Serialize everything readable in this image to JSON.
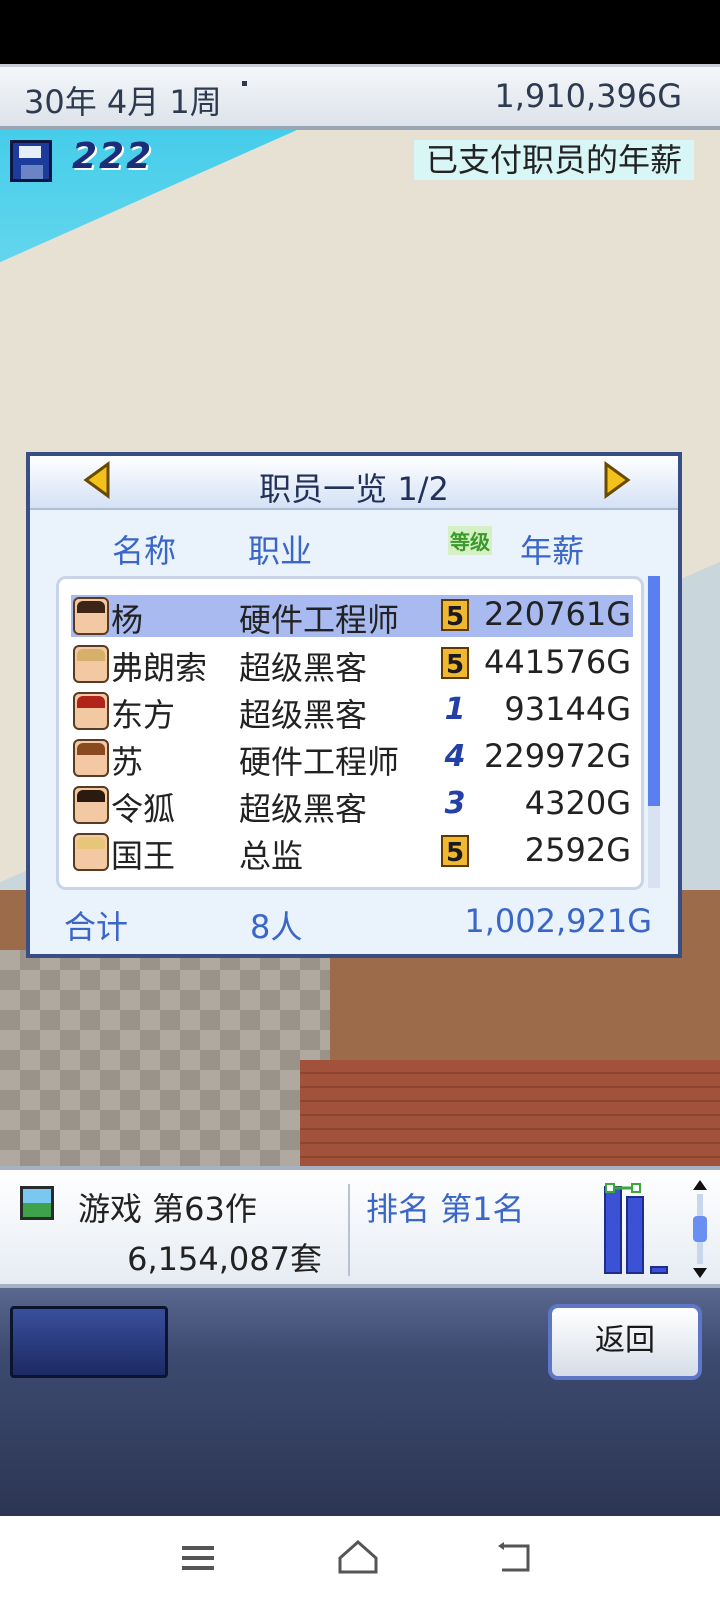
{
  "top_bar": {
    "date": "30年 4月 1周",
    "money": "1,910,396G"
  },
  "hud": {
    "save_count": "222",
    "notice": "已支付职员的年薪"
  },
  "staff_dialog": {
    "title": "职员一览 1/2",
    "columns": {
      "name": "名称",
      "job": "职业",
      "level": "等级",
      "salary": "年薪"
    },
    "rows": [
      {
        "name": "杨",
        "job": "硬件工程师",
        "level": "5",
        "salary": "220761G",
        "selected": true
      },
      {
        "name": "弗朗索",
        "job": "超级黑客",
        "level": "5",
        "salary": "441576G"
      },
      {
        "name": "东方",
        "job": "超级黑客",
        "level": "1",
        "salary": "93144G"
      },
      {
        "name": "苏",
        "job": "硬件工程师",
        "level": "4",
        "salary": "229972G"
      },
      {
        "name": "令狐",
        "job": "超级黑客",
        "level": "3",
        "salary": "4320G"
      },
      {
        "name": "国王",
        "job": "总监",
        "level": "5",
        "salary": "2592G"
      }
    ],
    "total": {
      "label": "合计",
      "count": "8人",
      "amount": "1,002,921G"
    }
  },
  "info_panel": {
    "game_label": "游戏 第63作",
    "sales": "6,154,087套",
    "rank": "排名 第1名"
  },
  "controls": {
    "back_label": "返回"
  },
  "colors": {
    "accent_blue": "#3a66c8",
    "dialog_border": "#3a4e86",
    "selection": "#a9baf0",
    "level_badge": "#f0b830"
  }
}
